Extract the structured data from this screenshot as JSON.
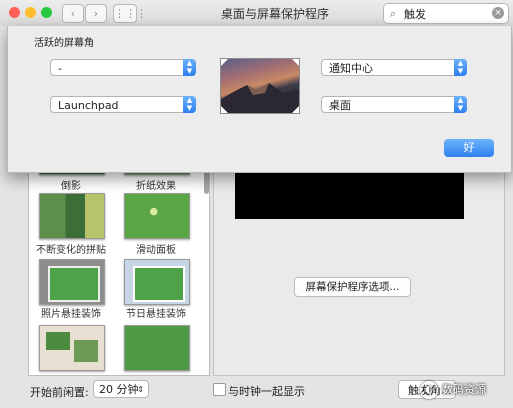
{
  "window": {
    "title": "桌面与屏幕保护程序"
  },
  "search": {
    "value": "触发"
  },
  "hot_corners": {
    "title": "活跃的屏幕角",
    "top_left": "-",
    "top_right": "通知中心",
    "bottom_left": "Launchpad",
    "bottom_right": "桌面",
    "ok_label": "好"
  },
  "screensavers": [
    {
      "label": "倒影"
    },
    {
      "label": "折纸效果"
    },
    {
      "label": "不断变化的拼贴"
    },
    {
      "label": "滑动面板"
    },
    {
      "label": "照片悬挂装饰"
    },
    {
      "label": "节日悬挂装饰"
    }
  ],
  "preview": {
    "options_label": "屏幕保护程序选项..."
  },
  "bottom": {
    "idle_label": "开始前闲置:",
    "idle_value": "20 分钟",
    "clock_label": "与时钟一起显示",
    "hot_corners_button": "触发角..."
  },
  "watermark": {
    "text": "数码资源"
  },
  "colors": {
    "accent": "#3b87f2",
    "traffic_close": "#ff5f57",
    "traffic_min": "#ffbd2e",
    "traffic_max": "#28c840"
  }
}
